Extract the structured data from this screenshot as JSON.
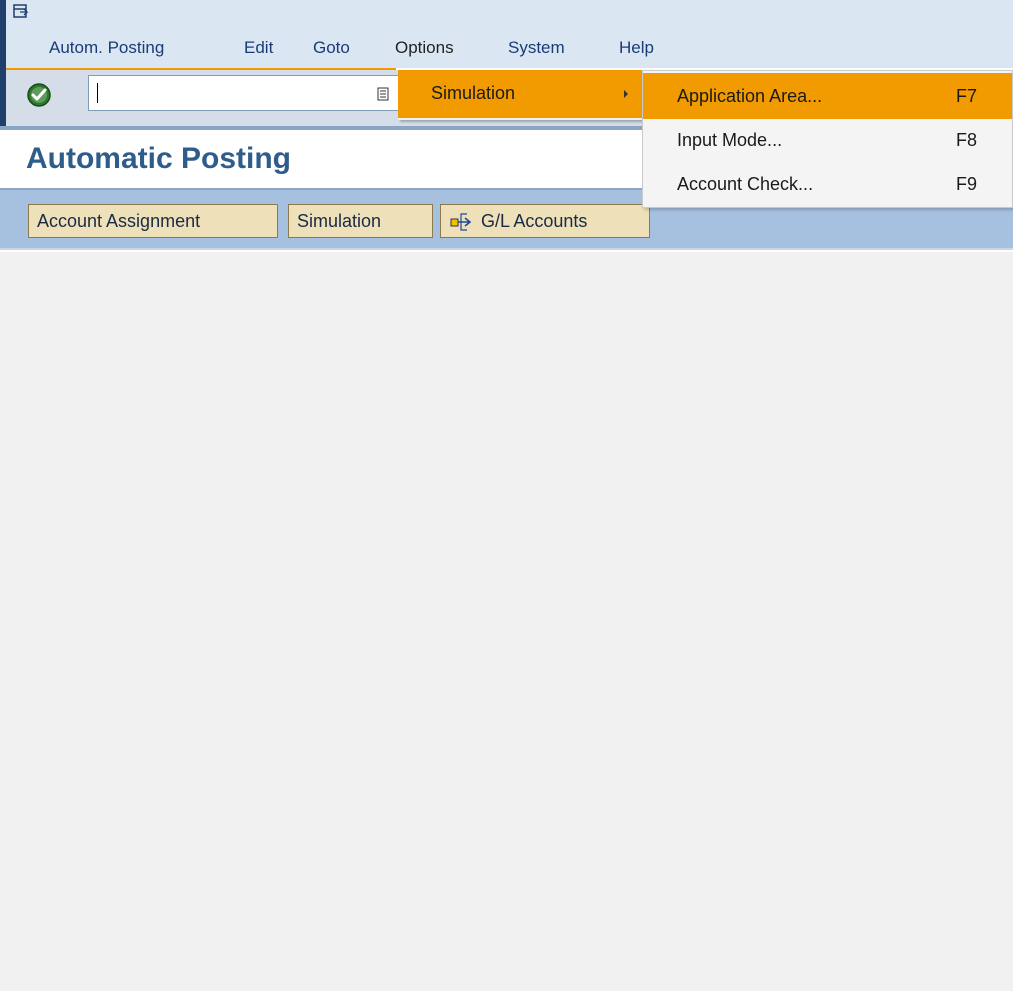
{
  "menubar": {
    "items": [
      {
        "label": "Autom. Posting"
      },
      {
        "label": "Edit"
      },
      {
        "label": "Goto"
      },
      {
        "label": "Options"
      },
      {
        "label": "System"
      },
      {
        "label": "Help"
      }
    ]
  },
  "toolbar": {
    "command_field_value": "",
    "ok_icon": "green-check-icon",
    "dropdown_icon": "history-list-icon"
  },
  "title": "Automatic Posting",
  "app_toolbar": {
    "buttons": [
      {
        "label": "Account Assignment"
      },
      {
        "label": "Simulation"
      },
      {
        "label": "G/L Accounts",
        "icon": "navigate-arrows-icon"
      }
    ]
  },
  "options_menu": {
    "items": [
      {
        "label": "Simulation",
        "has_submenu": true,
        "highlighted": true
      }
    ]
  },
  "simulation_submenu": {
    "items": [
      {
        "label": "Application Area...",
        "shortcut": "F7",
        "highlighted": true
      },
      {
        "label": "Input Mode...",
        "shortcut": "F8",
        "highlighted": false
      },
      {
        "label": "Account Check...",
        "shortcut": "F9",
        "highlighted": false
      }
    ]
  },
  "colors": {
    "menubar_bg": "#dbe6f3",
    "highlight": "#f29b00",
    "title": "#2f5d8b",
    "app_toolbar_bg": "#a6c0df",
    "button_bg": "#eee0b8",
    "content_bg": "#f1f1f1"
  }
}
